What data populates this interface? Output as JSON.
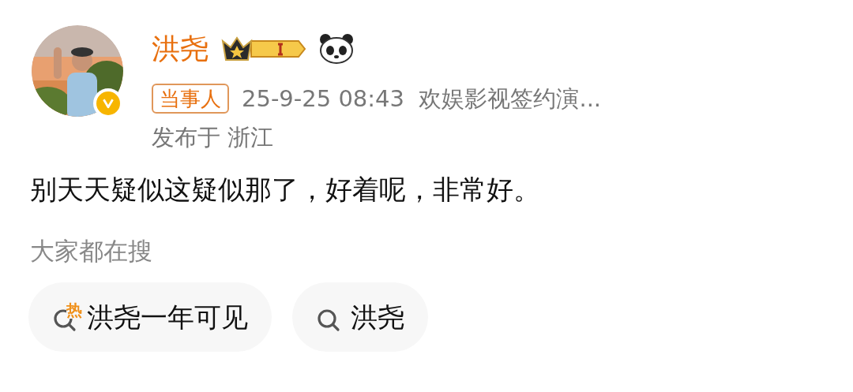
{
  "author": {
    "name": "洪尧",
    "tag": "当事人",
    "meta": "25-9-25 08:43  欢娱影视签约演...",
    "location": "发布于 浙江",
    "verified": true
  },
  "post": {
    "text": "别天天疑似这疑似那了，好着呢，非常好。"
  },
  "searches": {
    "title": "大家都在搜",
    "items": [
      {
        "kind": "hot",
        "badge": "热",
        "label": "洪尧一年可见"
      },
      {
        "kind": "search",
        "label": "洪尧"
      }
    ]
  }
}
